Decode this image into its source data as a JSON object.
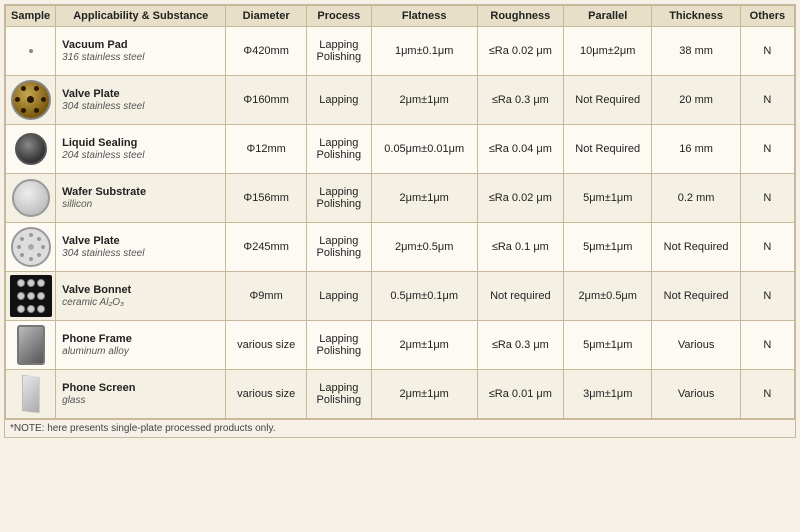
{
  "table": {
    "headers": [
      "Sample",
      "Applicability & Substance",
      "Diameter",
      "Process",
      "Flatness",
      "Roughness",
      "Parallel",
      "Thickness",
      "Others"
    ],
    "rows": [
      {
        "id": "vacuum-pad",
        "name": "Vacuum Pad",
        "sub": "316 stainless steel",
        "diameter": "Φ420mm",
        "process": "Lapping\nPolishing",
        "flatness": "1μm±0.1μm",
        "roughness": "≤Ra 0.02 μm",
        "parallel": "10μm±2μm",
        "thickness": "38 mm",
        "others": "N",
        "img_class": "img-vacuum-pad",
        "img_type": "circle"
      },
      {
        "id": "valve-plate-1",
        "name": "Valve Plate",
        "sub": "304 stainless steel",
        "diameter": "Φ160mm",
        "process": "Lapping",
        "flatness": "2μm±1μm",
        "roughness": "≤Ra 0.3 μm",
        "parallel": "Not Required",
        "thickness": "20 mm",
        "others": "N",
        "img_class": "img-valve-plate",
        "img_type": "circle-holes"
      },
      {
        "id": "liquid-sealing",
        "name": "Liquid Sealing",
        "sub": "204 stainless steel",
        "diameter": "Φ12mm",
        "process": "Lapping\nPolishing",
        "flatness": "0.05μm±0.01μm",
        "roughness": "≤Ra 0.04 μm",
        "parallel": "Not Required",
        "thickness": "16 mm",
        "others": "N",
        "img_class": "img-liquid-sealing",
        "img_type": "small-circle"
      },
      {
        "id": "wafer-substrate",
        "name": "Wafer Substrate",
        "sub": "sillicon",
        "diameter": "Φ156mm",
        "process": "Lapping\nPolishing",
        "flatness": "2μm±1μm",
        "roughness": "≤Ra 0.02 μm",
        "parallel": "5μm±1μm",
        "thickness": "0.2 mm",
        "others": "N",
        "img_class": "img-wafer",
        "img_type": "white-circle"
      },
      {
        "id": "valve-plate-2",
        "name": "Valve Plate",
        "sub": "304 stainless steel",
        "diameter": "Φ245mm",
        "process": "Lapping\nPolishing",
        "flatness": "2μm±0.5μm",
        "roughness": "≤Ra 0.1 μm",
        "parallel": "5μm±1μm",
        "thickness": "Not Required",
        "others": "N",
        "img_class": "img-valve-plate2",
        "img_type": "white-holes"
      },
      {
        "id": "valve-bonnet",
        "name": "Valve Bonnet",
        "sub": "ceramic Al₂O₃",
        "diameter": "Φ9mm",
        "process": "Lapping",
        "flatness": "0.5μm±0.1μm",
        "roughness": "Not required",
        "parallel": "2μm±0.5μm",
        "thickness": "Not Required",
        "others": "N",
        "img_class": "img-valve-bonnet",
        "img_type": "dots"
      },
      {
        "id": "phone-frame",
        "name": "Phone Frame",
        "sub": "aluminum alloy",
        "diameter": "various size",
        "process": "Lapping\nPolishing",
        "flatness": "2μm±1μm",
        "roughness": "≤Ra 0.3 μm",
        "parallel": "5μm±1μm",
        "thickness": "Various",
        "others": "N",
        "img_class": "img-phone-frame",
        "img_type": "phone-frame"
      },
      {
        "id": "phone-screen",
        "name": "Phone Screen",
        "sub": "glass",
        "diameter": "various size",
        "process": "Lapping\nPolishing",
        "flatness": "2μm±1μm",
        "roughness": "≤Ra 0.01 μm",
        "parallel": "3μm±1μm",
        "thickness": "Various",
        "others": "N",
        "img_class": "img-phone-screen",
        "img_type": "phone-screen"
      }
    ],
    "note": "*NOTE: here presents single-plate processed products only."
  }
}
